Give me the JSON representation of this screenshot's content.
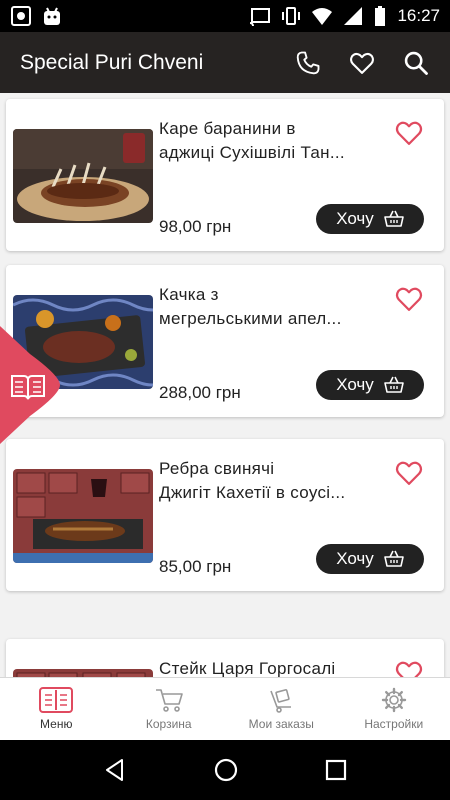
{
  "status_bar": {
    "time": "16:27"
  },
  "app_bar": {
    "title": "Special Puri Chveni"
  },
  "products": [
    {
      "name_line1": "Каре баранини в",
      "name_line2": "аджиці Сухішвілі Тан...",
      "price": "98,00 грн",
      "button": "Хочу"
    },
    {
      "name_line1": "Качка з",
      "name_line2": "мегрельськими апел...",
      "price": "288,00 грн",
      "button": "Хочу"
    },
    {
      "name_line1": "Ребра свинячі",
      "name_line2": "Джигіт Кахетії в соусі...",
      "price": "85,00 грн",
      "button": "Хочу"
    },
    {
      "name_line1": "Стейк Царя Горгосалі",
      "name_line2": "",
      "price": "",
      "button": ""
    }
  ],
  "bottom_nav": {
    "items": [
      {
        "label": "Меню",
        "icon": "menu-book-icon",
        "active": true
      },
      {
        "label": "Корзина",
        "icon": "cart-icon",
        "active": false
      },
      {
        "label": "Мои заказы",
        "icon": "orders-icon",
        "active": false
      },
      {
        "label": "Настройки",
        "icon": "gear-icon",
        "active": false
      }
    ]
  },
  "colors": {
    "app_bar": "#262322",
    "accent": "#e04a5f",
    "button": "#222222"
  }
}
